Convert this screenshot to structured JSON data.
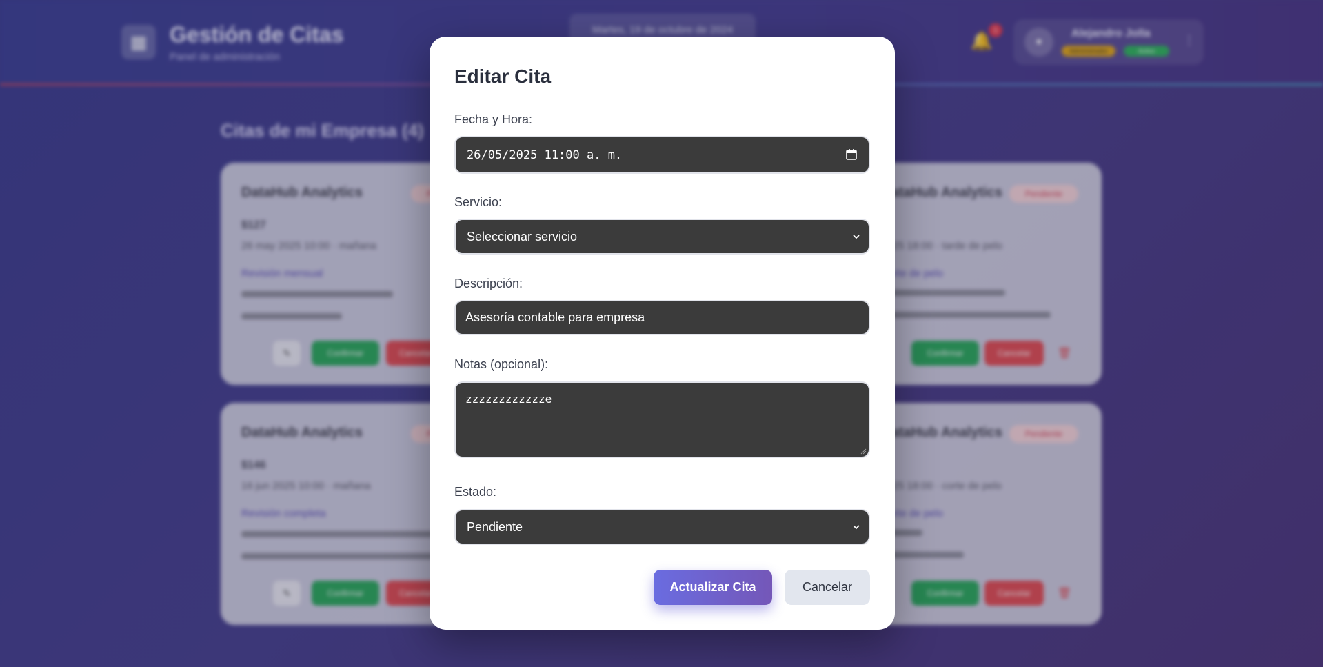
{
  "header": {
    "logo_icon": "calendar-icon",
    "title": "Gestión de Citas",
    "subtitle": "Panel de administración",
    "date_text": "Martes, 19 de octubre de 2024",
    "notification_count": "1",
    "user_name": "Alejandro Jolla",
    "role_badge": "Administrador",
    "status_badge": "Activo",
    "menu_glyph": "⋮"
  },
  "main": {
    "section_title": "Citas de mi Empresa (4)",
    "cards": [
      {
        "company": "DataHub Analytics",
        "status": "Pendiente",
        "price": "$127",
        "datetime": "26 may 2025 10:00 · mañana",
        "service": "Revisión mensual",
        "confirm": "Confirmar",
        "cancel": "Cancelar",
        "edit": "✎",
        "delete": "🗑"
      },
      {
        "company": "DataHub Analytics",
        "status": "Pendiente",
        "price": "",
        "datetime": "2025 18:00 · tarde de pelo",
        "service": "Corte de pelo",
        "confirm": "Confirmar",
        "cancel": "Cancelar",
        "edit": "✎",
        "delete": "🗑"
      },
      {
        "company": "DataHub Analytics",
        "status": "Pendiente",
        "price": "$146",
        "datetime": "16 jun 2025 10:00 · mañana",
        "service": "Revisión completa",
        "confirm": "Confirmar",
        "cancel": "Cancelar",
        "edit": "✎",
        "delete": "🗑"
      },
      {
        "company": "DataHub Analytics",
        "status": "Pendiente",
        "price": "",
        "datetime": "2025 18:00 · corte de pelo",
        "service": "Corte de pelo",
        "confirm": "Confirmar",
        "cancel": "Cancelar",
        "edit": "✎",
        "delete": "🗑"
      }
    ]
  },
  "modal": {
    "title": "Editar Cita",
    "datetime_label": "Fecha y Hora:",
    "datetime_value": "26/05/2025 11:00 a. m.",
    "service_label": "Servicio:",
    "service_selected": "Seleccionar servicio",
    "description_label": "Descripción:",
    "description_value": "Asesoría contable para empresa",
    "notes_label": "Notas (opcional):",
    "notes_value": "zzzzzzzzzzzze",
    "status_label": "Estado:",
    "status_selected": "Pendiente",
    "submit_label": "Actualizar Cita",
    "cancel_label": "Cancelar"
  },
  "colors": {
    "accent": "#6a6ce0",
    "field_bg": "#3b3b3b",
    "title": "#2a2f3d"
  }
}
